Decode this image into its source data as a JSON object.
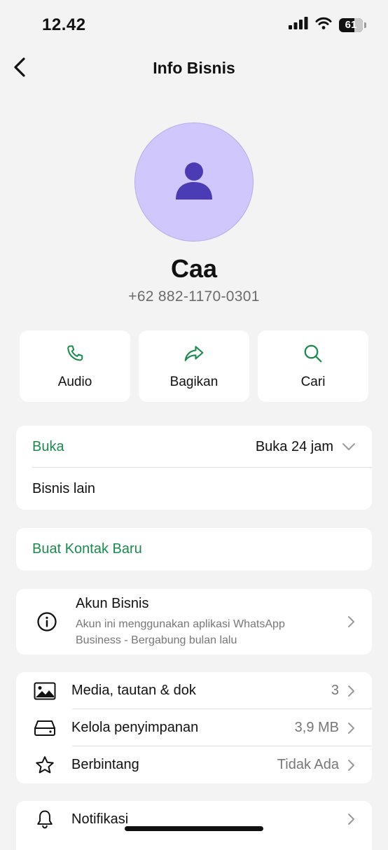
{
  "status": {
    "time": "12.42",
    "battery": "61"
  },
  "nav": {
    "title": "Info Bisnis"
  },
  "profile": {
    "name": "Caa",
    "phone": "+62 882-1170-0301"
  },
  "actions": [
    {
      "label": "Audio",
      "icon": "phone-icon"
    },
    {
      "label": "Bagikan",
      "icon": "share-icon"
    },
    {
      "label": "Cari",
      "icon": "search-icon"
    }
  ],
  "hours": {
    "label": "Buka",
    "value": "Buka 24 jam",
    "other": "Bisnis lain"
  },
  "new_contact": {
    "label": "Buat Kontak Baru"
  },
  "business_account": {
    "title": "Akun Bisnis",
    "subtitle": "Akun ini menggunakan aplikasi WhatsApp Business - Bergabung bulan lalu"
  },
  "media_section": [
    {
      "label": "Media, tautan & dok",
      "value": "3",
      "icon": "image-icon"
    },
    {
      "label": "Kelola penyimpanan",
      "value": "3,9 MB",
      "icon": "storage-icon"
    },
    {
      "label": "Berbintang",
      "value": "Tidak Ada",
      "icon": "star-icon"
    }
  ],
  "notifications": {
    "label": "Notifikasi",
    "icon": "bell-icon"
  },
  "colors": {
    "accent": "#1a8a4d",
    "avatar_bg": "#d0c8fc",
    "avatar_icon": "#4b3bb5",
    "background": "#f3f3f3"
  }
}
